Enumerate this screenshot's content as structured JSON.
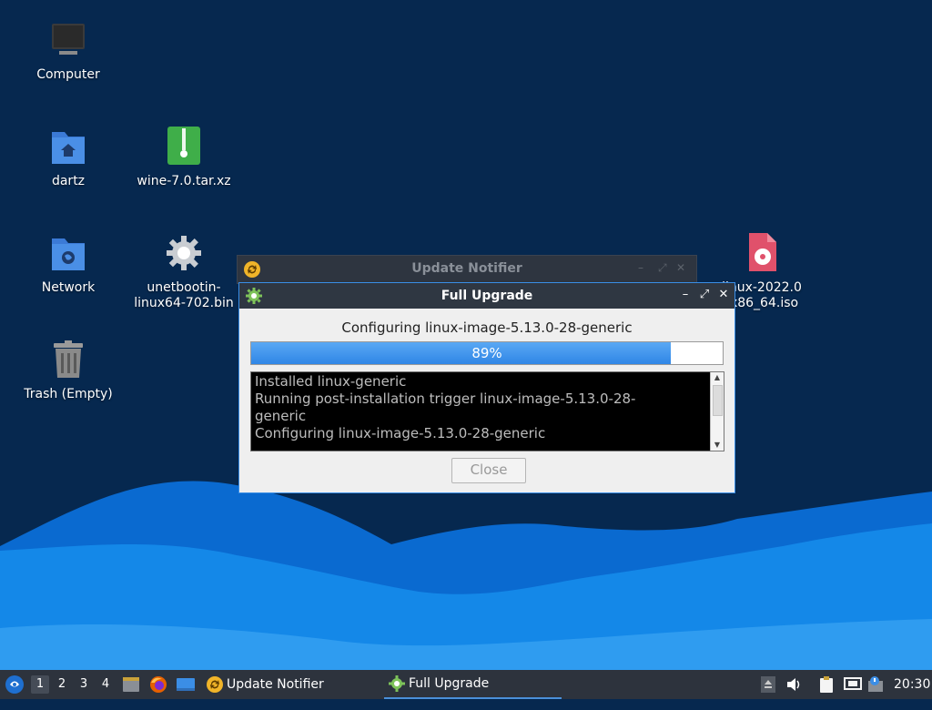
{
  "desktop": {
    "icons": [
      {
        "label": "Computer",
        "icon": "monitor-icon"
      },
      {
        "label": "dartz",
        "icon": "home-folder-icon"
      },
      {
        "label": "wine-7.0.tar.xz",
        "icon": "archive-icon"
      },
      {
        "label": "Network",
        "icon": "network-folder-icon"
      },
      {
        "label": "unetbootin-linux64-702.bin",
        "line1": "unetbootin-",
        "line2": "linux64-702.bin",
        "icon": "gear-icon"
      },
      {
        "label": "Trash (Empty)",
        "icon": "trash-icon"
      },
      {
        "line1": "linux-2022.0",
        "line2": "-x86_64.iso",
        "icon": "disc-image-icon"
      }
    ]
  },
  "update_notifier": {
    "title": "Update Notifier",
    "controls": [
      "–",
      "⤢",
      "✕"
    ]
  },
  "dialog": {
    "title": "Full Upgrade",
    "status": "Configuring linux-image-5.13.0-28-generic",
    "progress": 0.89,
    "progress_label": "89%",
    "log_lines": [
      "Installed linux-generic",
      "Running post-installation trigger linux-image-5.13.0-28-",
      "generic",
      "Configuring linux-image-5.13.0-28-generic"
    ],
    "close_label": "Close",
    "controls": [
      "–",
      "⤢",
      "✕"
    ]
  },
  "taskbar": {
    "workspaces": [
      "1",
      "2",
      "3",
      "4"
    ],
    "active_workspace": "1",
    "tasks": [
      {
        "label": "Update Notifier",
        "icon": "update-notifier-icon"
      },
      {
        "label": "Full Upgrade",
        "icon": "upgrade-gear-icon"
      }
    ],
    "clock": "20:30"
  },
  "colors": {
    "desktop_bg": "#06284f",
    "wave_light": "#1488e8",
    "accent": "#3a8ee6"
  }
}
